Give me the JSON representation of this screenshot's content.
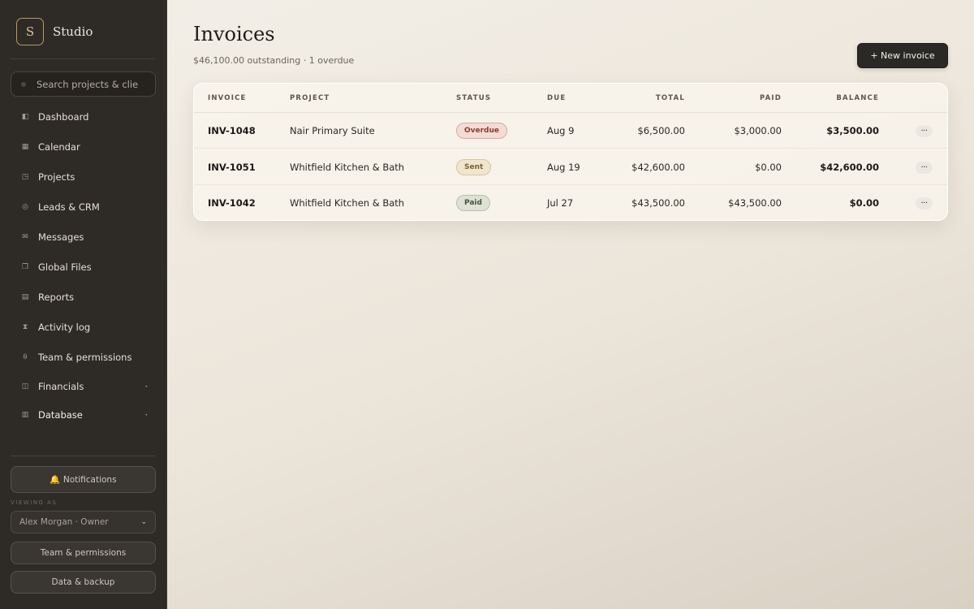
{
  "brand": {
    "logo_letter": "S",
    "name": "Studio"
  },
  "search": {
    "placeholder": "Search projects & clie"
  },
  "nav": [
    {
      "icon": "dashboard-icon",
      "glyph": "◧",
      "label": "Dashboard"
    },
    {
      "icon": "calendar-icon",
      "glyph": "▦",
      "label": "Calendar"
    },
    {
      "icon": "projects-icon",
      "glyph": "◳",
      "label": "Projects"
    },
    {
      "icon": "leads-icon",
      "glyph": "◎",
      "label": "Leads & CRM"
    },
    {
      "icon": "messages-icon",
      "glyph": "✉",
      "label": "Messages"
    },
    {
      "icon": "files-icon",
      "glyph": "❐",
      "label": "Global Files"
    },
    {
      "icon": "reports-icon",
      "glyph": "▤",
      "label": "Reports"
    },
    {
      "icon": "activity-icon",
      "glyph": "⧗",
      "label": "Activity log"
    },
    {
      "icon": "team-icon",
      "glyph": "⍬",
      "label": "Team & permissions"
    },
    {
      "icon": "financials-icon",
      "glyph": "◫",
      "label": "Financials",
      "caret": "•"
    },
    {
      "icon": "database-icon",
      "glyph": "▥",
      "label": "Database",
      "caret": "•"
    }
  ],
  "sidebar_footer": {
    "notifications_label": "🔔 Notifications",
    "viewing_as_label": "VIEWING AS",
    "role_value": "Alex Morgan · Owner",
    "team_button": "Team & permissions",
    "data_button": "Data & backup"
  },
  "page": {
    "title": "Invoices",
    "subtitle": "$46,100.00 outstanding · 1 overdue",
    "new_button": "+ New invoice"
  },
  "table": {
    "headers": {
      "invoice": "INVOICE",
      "project": "PROJECT",
      "status": "STATUS",
      "due": "DUE",
      "total": "TOTAL",
      "paid": "PAID",
      "balance": "BALANCE"
    },
    "rows": [
      {
        "invoice": "INV-1048",
        "project": "Nair Primary Suite",
        "status": "Overdue",
        "status_kind": "overdue",
        "due": "Aug 9",
        "total": "$6,500.00",
        "paid": "$3,000.00",
        "balance": "$3,500.00",
        "more": "···"
      },
      {
        "invoice": "INV-1051",
        "project": "Whitfield Kitchen & Bath",
        "status": "Sent",
        "status_kind": "sent",
        "due": "Aug 19",
        "total": "$42,600.00",
        "paid": "$0.00",
        "balance": "$42,600.00",
        "more": "···"
      },
      {
        "invoice": "INV-1042",
        "project": "Whitfield Kitchen & Bath",
        "status": "Paid",
        "status_kind": "paid",
        "due": "Jul 27",
        "total": "$43,500.00",
        "paid": "$43,500.00",
        "balance": "$0.00",
        "more": "···"
      }
    ]
  },
  "colors": {
    "sidebar_bg": "#2e2b27",
    "accent_gold": "#b89a5e",
    "overdue": "#8b3a2b",
    "sent": "#7a6237",
    "paid": "#46543e"
  }
}
